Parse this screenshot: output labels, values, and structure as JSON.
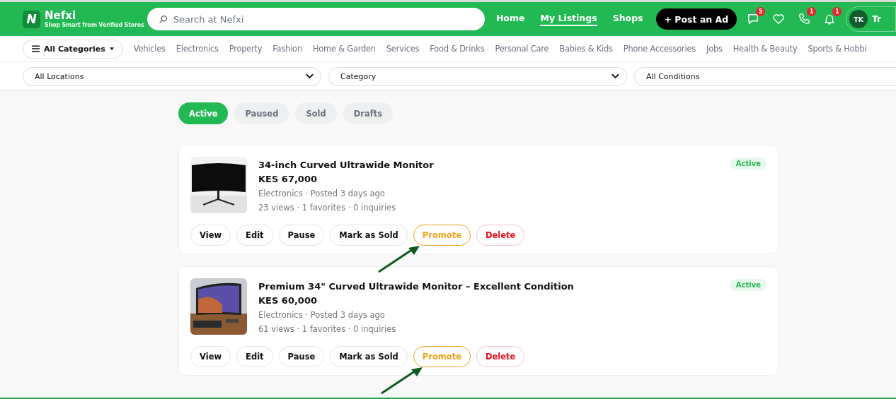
{
  "header": {
    "logo_letter": "N",
    "brand": "Nefxi",
    "tagline": "Shop Smart from Verified Stores",
    "search": {
      "placeholder": "Search at Nefxi"
    },
    "nav": [
      {
        "label": "Home",
        "selected": false
      },
      {
        "label": "My Listings",
        "selected": true
      },
      {
        "label": "Shops",
        "selected": false
      }
    ],
    "post_button": "+ Post an Ad",
    "icons": [
      {
        "kind": "chat",
        "badge": "5"
      },
      {
        "kind": "heart"
      },
      {
        "kind": "phone",
        "badge": "1"
      },
      {
        "kind": "bell",
        "badge": "1"
      }
    ],
    "profile": {
      "initials": "TK",
      "name": "Tr"
    }
  },
  "category_bar": {
    "menu_label": "All Categories",
    "items": [
      "Vehicles",
      "Electronics",
      "Property",
      "Fashion",
      "Home & Garden",
      "Services",
      "Food & Drinks",
      "Personal Care",
      "Babies & Kids",
      "Phone Accessories",
      "Jobs",
      "Health & Beauty",
      "Sports & Hobbi"
    ]
  },
  "filters": [
    {
      "label": "All Locations",
      "cut_off": false
    },
    {
      "label": "Category",
      "cut_off": false
    },
    {
      "label": "All Conditions",
      "cut_off": true
    }
  ],
  "tabs": [
    {
      "label": "Active",
      "selected": true
    },
    {
      "label": "Paused",
      "selected": false
    },
    {
      "label": "Sold",
      "selected": false
    },
    {
      "label": "Drafts",
      "selected": false
    }
  ],
  "listings": [
    {
      "title": "34-inch Curved Ultrawide Monitor",
      "price": "KES 67,000",
      "meta": "Electronics · Posted 3 days ago",
      "stats": "23 views · 1 favorites · 0 inquiries",
      "status": "Active",
      "actions": [
        {
          "label": "View",
          "kind": "default"
        },
        {
          "label": "Edit",
          "kind": "default"
        },
        {
          "label": "Pause",
          "kind": "default"
        },
        {
          "label": "Mark as Sold",
          "kind": "default"
        },
        {
          "label": "Promote",
          "kind": "promote"
        },
        {
          "label": "Delete",
          "kind": "delete"
        }
      ]
    },
    {
      "title": "Premium 34\" Curved Ultrawide Monitor – Excellent Condition",
      "price": "KES 60,000",
      "meta": "Electronics · Posted 3 days ago",
      "stats": "61 views · 1 favorites · 0 inquiries",
      "status": "Active",
      "actions": [
        {
          "label": "View",
          "kind": "default"
        },
        {
          "label": "Edit",
          "kind": "default"
        },
        {
          "label": "Pause",
          "kind": "default"
        },
        {
          "label": "Mark as Sold",
          "kind": "default"
        },
        {
          "label": "Promote",
          "kind": "promote"
        },
        {
          "label": "Delete",
          "kind": "delete"
        }
      ]
    }
  ]
}
